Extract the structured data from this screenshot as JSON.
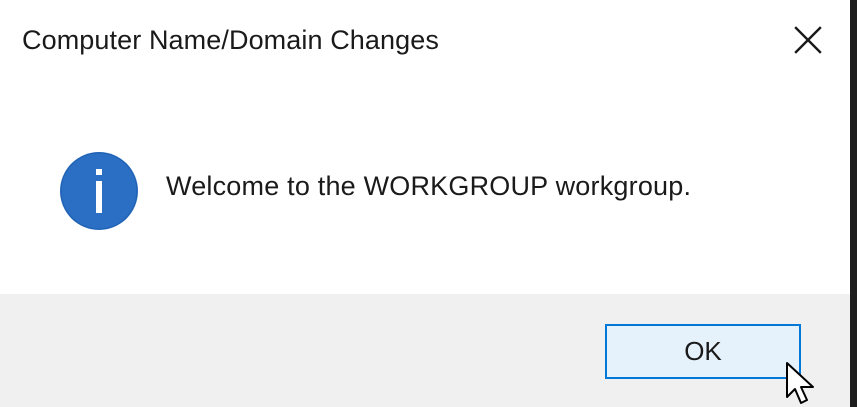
{
  "dialog": {
    "title": "Computer Name/Domain Changes",
    "close_icon": "close-icon",
    "message": "Welcome to the WORKGROUP workgroup.",
    "message_icon": "info-icon",
    "ok_label": "OK"
  },
  "cursor": {
    "icon": "mouse-pointer-icon"
  },
  "colors": {
    "dialog_background": "#ffffff",
    "footer_background": "#f0f0f0",
    "info_icon_fill": "#2b6fc4",
    "button_background": "#e5f1fb",
    "button_border": "#0078d7",
    "text": "#1a1a1a"
  }
}
